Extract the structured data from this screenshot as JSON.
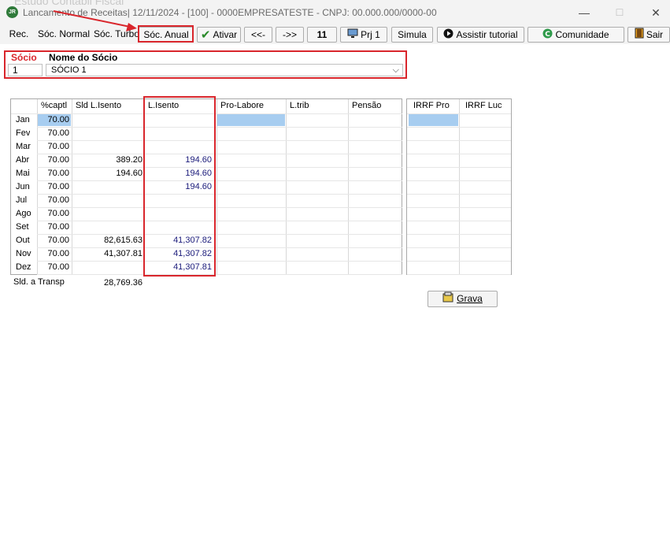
{
  "window": {
    "title": "Lancamento de Receitas| 12/11/2024 - [100] - 0000EMPRESATESTE - CNPJ: 00.000.000/0000-00",
    "ghost_text": "Estudo Contabil Fiscal",
    "app_icon_text": "JR",
    "minimize": "—",
    "maximize": "☐",
    "close": "✕"
  },
  "toolbar": {
    "rec": "Rec.",
    "soc_normal": "Sóc. Normal",
    "soc_turbo": "Sóc. Turbo",
    "soc_anual": "Sóc. Anual",
    "ativar": "Ativar",
    "prev": "<<-",
    "next": "->>",
    "count": "11",
    "prj": "Prj 1",
    "simula": "Simula",
    "tutorial": "Assistir tutorial",
    "comunidade": "Comunidade",
    "sair": "Sair"
  },
  "socio": {
    "label_num": "Sócio",
    "label_name": "Nome do Sócio",
    "number": "1",
    "name": "SÓCIO 1"
  },
  "table": {
    "headers": [
      "%captl",
      "Sld L.Isento",
      "L.Isento",
      "Pro-Labore",
      "L.trib",
      "Pensão"
    ],
    "rows": [
      {
        "month": "Jan",
        "captl": "70.00",
        "sld": "",
        "isento": ""
      },
      {
        "month": "Fev",
        "captl": "70.00",
        "sld": "",
        "isento": ""
      },
      {
        "month": "Mar",
        "captl": "70.00",
        "sld": "",
        "isento": ""
      },
      {
        "month": "Abr",
        "captl": "70.00",
        "sld": "389.20",
        "isento": "194.60"
      },
      {
        "month": "Mai",
        "captl": "70.00",
        "sld": "194.60",
        "isento": "194.60"
      },
      {
        "month": "Jun",
        "captl": "70.00",
        "sld": "",
        "isento": "194.60"
      },
      {
        "month": "Jul",
        "captl": "70.00",
        "sld": "",
        "isento": ""
      },
      {
        "month": "Ago",
        "captl": "70.00",
        "sld": "",
        "isento": ""
      },
      {
        "month": "Set",
        "captl": "70.00",
        "sld": "",
        "isento": ""
      },
      {
        "month": "Out",
        "captl": "70.00",
        "sld": "82,615.63",
        "isento": "41,307.82"
      },
      {
        "month": "Nov",
        "captl": "70.00",
        "sld": "41,307.81",
        "isento": "41,307.82"
      },
      {
        "month": "Dez",
        "captl": "70.00",
        "sld": "",
        "isento": "41,307.81"
      }
    ]
  },
  "irrf": {
    "headers": [
      "IRRF Pro",
      "IRRF Luc"
    ]
  },
  "footer": {
    "sld_transp_label": "Sld. a Transp",
    "sld_transp_value": "28,769.36"
  },
  "grava_label": "Grava",
  "colors": {
    "highlight_red": "#d9262c",
    "selected_cell": "#a7cdf0",
    "value_blue": "#1a1a7a"
  }
}
